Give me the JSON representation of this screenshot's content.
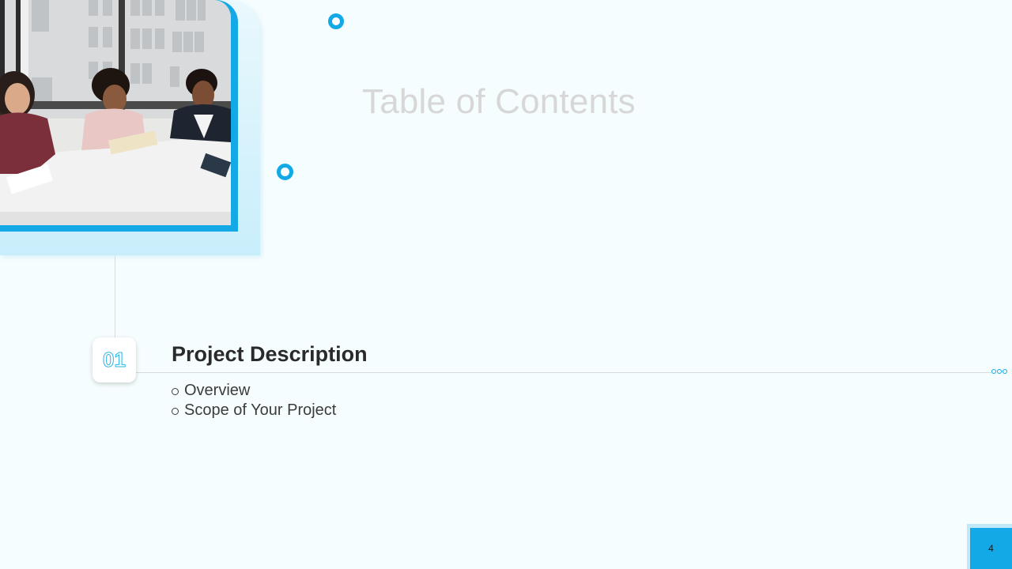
{
  "slide": {
    "title": "Table of Contents",
    "page_number": "4"
  },
  "photo": {
    "description_icon": "meeting-photo"
  },
  "sections": [
    {
      "number": "01",
      "title": "Project Description",
      "items": [
        "Overview",
        "Scope of Your Project"
      ]
    }
  ],
  "colors": {
    "accent": "#12a9e6",
    "background": "#f6fdfe",
    "title": "#d7d7d7",
    "text": "#2a2a2a"
  }
}
